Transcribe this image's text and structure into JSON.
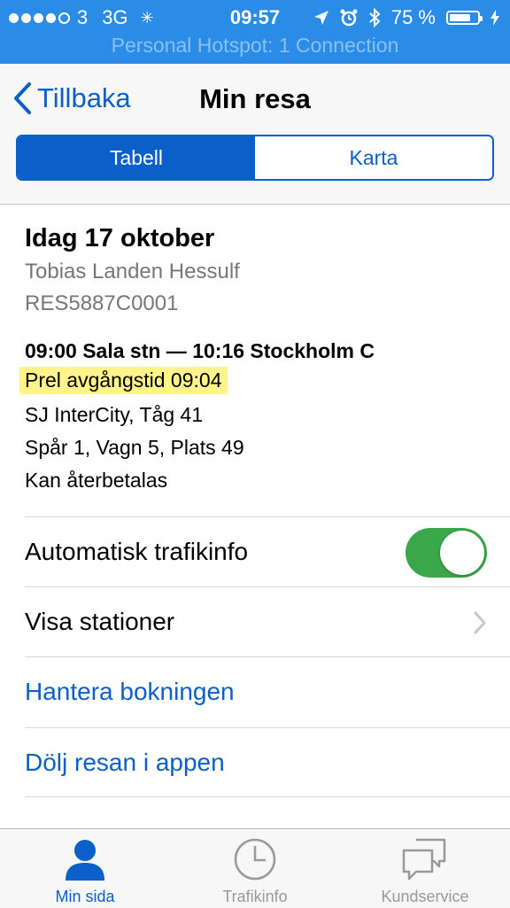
{
  "status_bar": {
    "signal_dots_filled": 4,
    "signal_dots_total": 5,
    "carrier": "3",
    "network": "3G",
    "time": "09:57",
    "battery_percent": "75 %",
    "battery_level": 0.75,
    "hotspot": "Personal Hotspot: 1 Connection"
  },
  "nav": {
    "back_label": "Tillbaka",
    "title": "Min resa",
    "segments": [
      "Tabell",
      "Karta"
    ],
    "selected_segment": "Tabell"
  },
  "trip": {
    "date": "Idag 17 oktober",
    "traveler": "Tobias Landen Hessulf",
    "reference": "RES5887C0001",
    "route": "09:00 Sala stn — 10:16 Stockholm C",
    "prel_departure": "Prel avgångstid 09:04",
    "train": "SJ InterCity, Tåg 41",
    "seat": "Spår 1, Vagn 5, Plats 49",
    "refund": "Kan återbetalas"
  },
  "options": {
    "auto_traffic_label": "Automatisk trafikinfo",
    "auto_traffic_on": true,
    "show_stations_label": "Visa stationer",
    "manage_booking_label": "Hantera bokningen",
    "hide_trip_label": "Dölj resan i appen"
  },
  "tabbar": {
    "items": [
      {
        "label": "Min sida",
        "icon": "person-icon"
      },
      {
        "label": "Trafikinfo",
        "icon": "clock-icon"
      },
      {
        "label": "Kundservice",
        "icon": "chat-bubbles-icon"
      }
    ],
    "active_index": 0
  },
  "colors": {
    "status_bar": "#2a8ce6",
    "accent": "#0a5fc9",
    "toggle_on": "#3aa84a",
    "highlight": "#fff48a"
  }
}
